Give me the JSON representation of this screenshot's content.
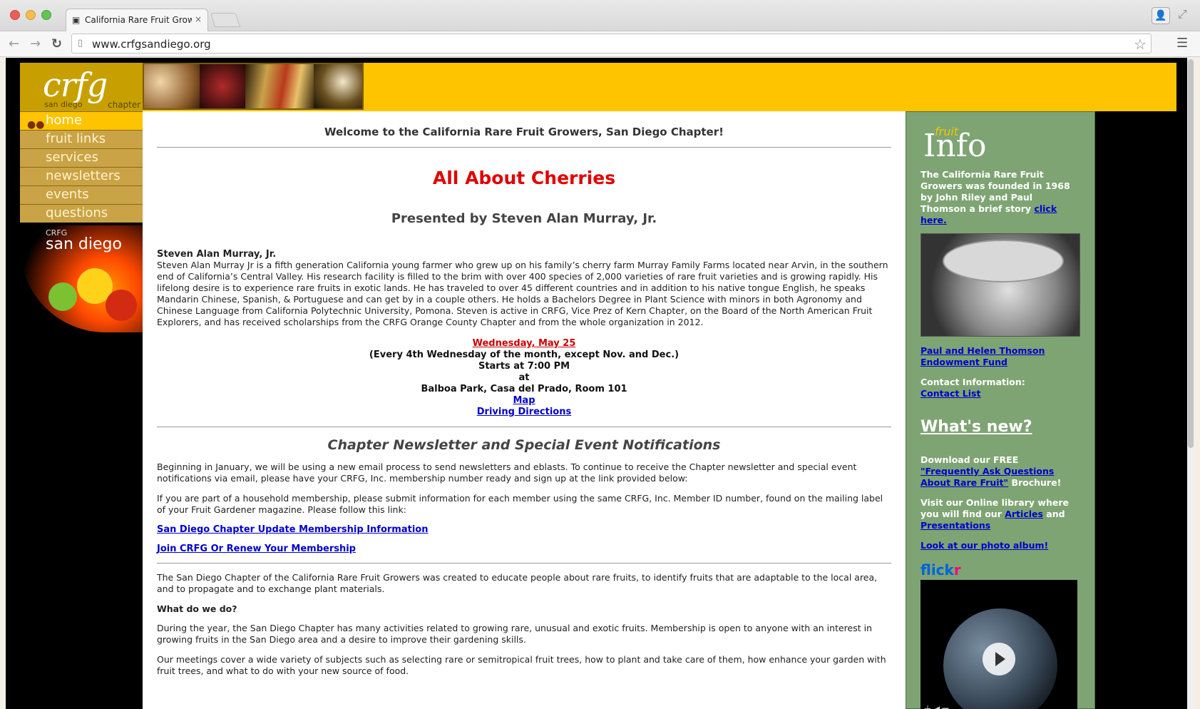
{
  "browser": {
    "tab_title": "California Rare Fruit Grow",
    "tab_close": "×",
    "url": "www.crfgsandiego.org"
  },
  "logo": {
    "text": "crfg",
    "sub_left": "san diego",
    "sub_right": "chapter"
  },
  "nav": {
    "items": [
      {
        "label": "home"
      },
      {
        "label": "fruit links"
      },
      {
        "label": "services"
      },
      {
        "label": "newsletters"
      },
      {
        "label": "events"
      },
      {
        "label": "questions"
      }
    ],
    "art_crfg": "CRFG",
    "art_sd": "san diego"
  },
  "main": {
    "welcome": "Welcome to the California Rare Fruit Growers, San Diego Chapter!",
    "event_title": "All About Cherries",
    "presenter": "Presented by Steven Alan Murray, Jr.",
    "bio_name": "Steven Alan Murray, Jr.",
    "bio_text": "Steven Alan Murray Jr is a fifth generation California young farmer who grew up on his family’s cherry farm Murray Family Farms located near Arvin, in the southern end of California’s Central Valley. His research facility is filled to the brim with over 400 species of 2,000 varieties of rare fruit varieties and is growing rapidly. His lifelong desire is to experience rare fruits in exotic lands. He has traveled to over 45 different countries and in addition to his native tongue English, he speaks Mandarin Chinese, Spanish, & Portuguese and can get by in a couple others.  He holds a Bachelors Degree in Plant Science with minors in both Agronomy and Chinese Language from California Polytechnic University, Pomona. Steven is active in CRFG, Vice Prez of Kern Chapter, on the Board of the North American Fruit Explorers, and has received scholarships from the CRFG Orange County Chapter and from the whole organization in 2012.",
    "schedule": {
      "date": "Wednesday, May 25",
      "recurrence": "(Every 4th Wednesday of the month, except Nov. and Dec.)",
      "time": "Starts at 7:00 PM",
      "at": "at",
      "location": "Balboa Park, Casa del Prado, Room 101",
      "map_link": "Map",
      "directions_link": "Driving Directions"
    },
    "newsletter_title": "Chapter Newsletter and Special Event Notifications",
    "newsletter_p1": "Beginning in January, we will be using a new email process to send newsletters and eblasts. To continue to receive the Chapter newsletter and special event notifications via email, please have your CRFG, Inc. membership number ready and sign up at the link provided below:",
    "newsletter_p2": "If you are part of a household membership, please submit information for each member using the same CRFG, Inc. Member ID number, found on the mailing label of your Fruit Gardener magazine. Please follow this link:",
    "update_link": "San Diego Chapter Update Membership Information",
    "join_link": "Join CRFG Or Renew Your Membership",
    "about_p": "The San Diego Chapter of the California Rare Fruit Growers was created to educate people about rare fruits, to identify fruits that are adaptable to the local area, and to propagate and to exchange plant materials.",
    "what_heading": "What do we do?",
    "what_p": "During the year, the San Diego Chapter has many activities related to growing rare, unusual and exotic fruits. Membership is open to anyone with an interest in growing fruits in the San Diego area and a desire to improve their gardening skills.",
    "meetings_p": "Our meetings cover a wide variety of subjects such as selecting rare or semitropical fruit trees, how to plant and take care of them, how enhance your garden with fruit trees, and what to do with your new source of food."
  },
  "sidebar": {
    "info_small": "fruit",
    "info_big": "Info",
    "history_text": "The California Rare Fruit Growers was founded in 1968 by John Riley and Paul Thomson a brief story",
    "history_link": "click here.",
    "endowment_link": "Paul and Helen Thomson Endowment Fund",
    "contact_label": "Contact Information:",
    "contact_link": "Contact List",
    "whats_new": "What's new?",
    "download_text": "Download our FREE",
    "download_link": "\"Frequently Ask Questions About Rare Fruit\"",
    "download_tail": "Brochure!",
    "library_text": "Visit our Online library where you will find our",
    "articles_link": "Articles",
    "library_and": "and",
    "presentations_link": "Presentations",
    "photo_link": "Look at our photo album!",
    "flickr_main": "flick",
    "flickr_r": "r"
  }
}
